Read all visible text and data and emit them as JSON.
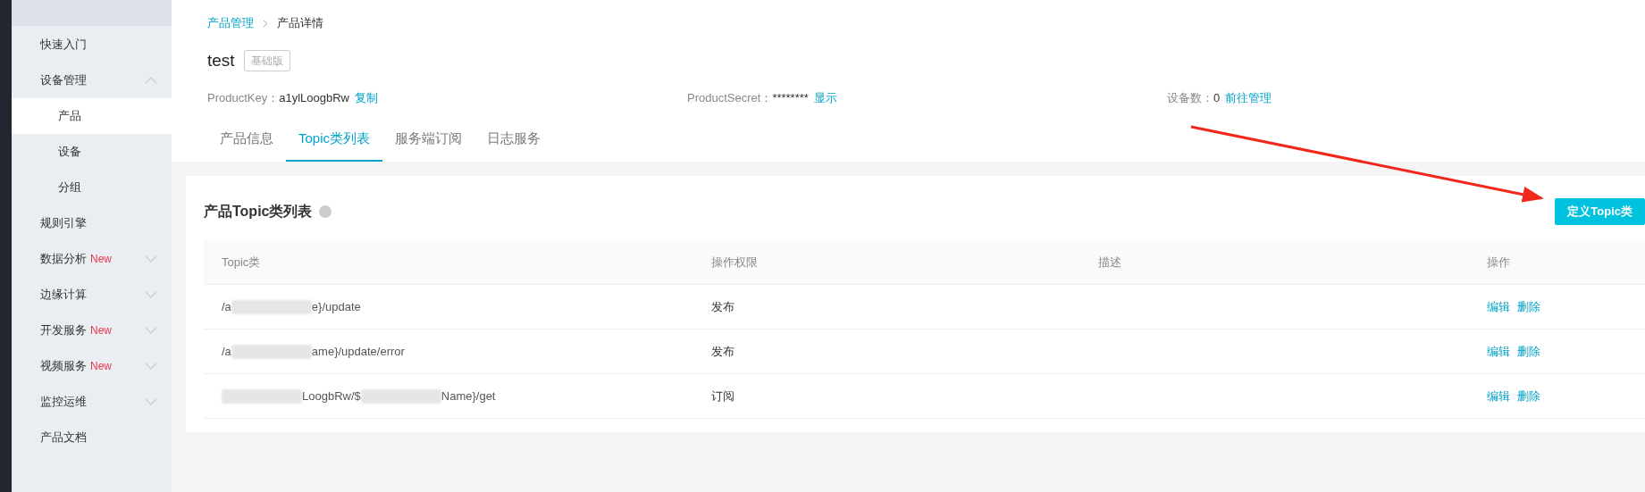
{
  "sidebar": {
    "items": [
      {
        "label": "快速入门",
        "selected": false
      },
      {
        "label": "设备管理",
        "selected": false,
        "expanded": true,
        "children": [
          {
            "label": "产品",
            "selected": true
          },
          {
            "label": "设备",
            "selected": false
          },
          {
            "label": "分组",
            "selected": false
          }
        ]
      },
      {
        "label": "规则引擎",
        "selected": false
      },
      {
        "label": "数据分析",
        "badge": "New",
        "selected": false,
        "expanded": false
      },
      {
        "label": "边缘计算",
        "selected": false,
        "expanded": false
      },
      {
        "label": "开发服务",
        "badge": "New",
        "selected": false,
        "expanded": false
      },
      {
        "label": "视频服务",
        "badge": "New",
        "selected": false,
        "expanded": false
      },
      {
        "label": "监控运维",
        "selected": false,
        "expanded": false
      },
      {
        "label": "产品文档",
        "selected": false
      }
    ]
  },
  "breadcrumb": [
    {
      "label": "产品管理",
      "kind": "link"
    },
    {
      "label": "产品详情",
      "kind": "current"
    }
  ],
  "product": {
    "name": "test",
    "edition": "基础版"
  },
  "info": [
    {
      "label": "ProductKey：",
      "value": "a1ylLoogbRw",
      "action": "复制"
    },
    {
      "label": "ProductSecret：",
      "value": "********",
      "action": "显示"
    },
    {
      "label": "设备数：",
      "value": "0",
      "action": "前往管理"
    }
  ],
  "tabs": [
    {
      "label": "产品信息",
      "selected": false
    },
    {
      "label": "Topic类列表",
      "selected": true
    },
    {
      "label": "服务端订阅",
      "selected": false
    },
    {
      "label": "日志服务",
      "selected": false
    }
  ],
  "card": {
    "title": "产品Topic类列表",
    "button": "定义Topic类",
    "table": {
      "columns": [
        "Topic类",
        "操作权限",
        "描述",
        "操作"
      ],
      "rows": [
        {
          "topic": [
            {
              "kind": "text",
              "text": "/a"
            },
            {
              "kind": "redacted"
            },
            {
              "kind": "text",
              "text": "e}/update"
            }
          ],
          "permission": "发布",
          "actions": [
            "编辑",
            "删除"
          ]
        },
        {
          "topic": [
            {
              "kind": "text",
              "text": "/a"
            },
            {
              "kind": "redacted"
            },
            {
              "kind": "text",
              "text": "ame}/update/error"
            }
          ],
          "permission": "发布",
          "actions": [
            "编辑",
            "删除"
          ]
        },
        {
          "topic": [
            {
              "kind": "redacted"
            },
            {
              "kind": "text",
              "text": "LoogbRw/$"
            },
            {
              "kind": "redacted"
            },
            {
              "kind": "text",
              "text": "Name}/get"
            }
          ],
          "permission": "订阅",
          "actions": [
            "编辑",
            "删除"
          ]
        }
      ]
    }
  }
}
